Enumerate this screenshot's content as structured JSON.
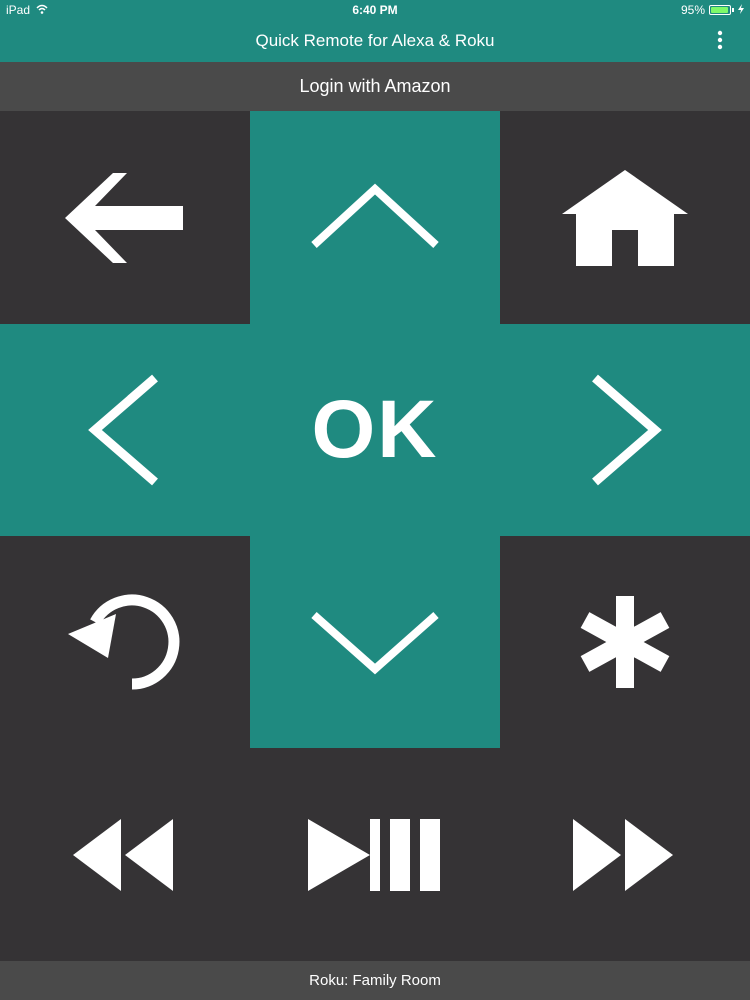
{
  "status_bar": {
    "device": "iPad",
    "time": "6:40 PM",
    "battery_percent": "95%",
    "battery_level": 0.95,
    "icons": [
      "wifi-icon",
      "battery-icon",
      "charging-icon"
    ]
  },
  "nav": {
    "title": "Quick Remote for Alexa & Roku",
    "menu_icon": "more-vertical-icon"
  },
  "login": {
    "label": "Login with Amazon"
  },
  "remote": {
    "ok_label": "OK",
    "buttons": [
      "back-arrow-icon",
      "up-chevron-icon",
      "home-icon",
      "left-chevron-icon",
      "right-chevron-icon",
      "replay-icon",
      "down-chevron-icon",
      "asterisk-icon",
      "rewind-icon",
      "play-pause-icon",
      "fast-forward-icon"
    ]
  },
  "footer": {
    "device_label": "Roku: Family Room"
  },
  "colors": {
    "accent": "#1f8a80",
    "dark": "#353335",
    "bar": "#4a4a4a",
    "icon": "#ffffff",
    "battery": "#7dfa6a"
  }
}
